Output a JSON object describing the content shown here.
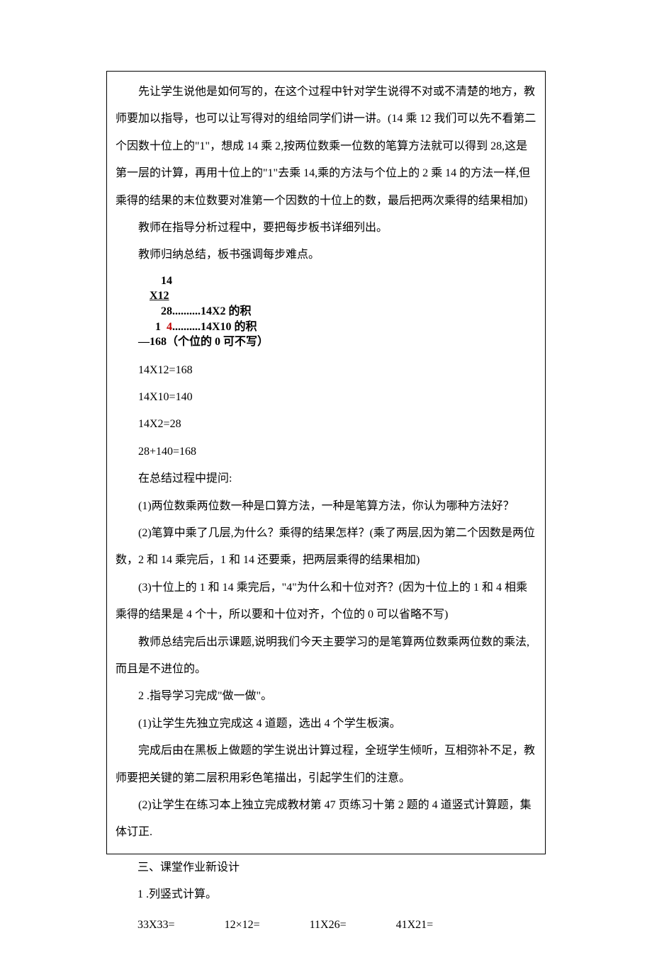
{
  "main": {
    "p1": "先让学生说他是如何写的，在这个过程中针对学生说得不对或不清楚的地方，教师要加以指导，也可以让写得对的组给同学们讲一讲。(14 乘 12 我们可以先不看第二个因数十位上的\"1\"，想成 14 乘 2,按两位数乘一位数的笔算方法就可以得到 28,这是第一层的计算，再用十位上的\"1\"去乘 14,乘的方法与个位上的 2 乘 14 的方法一样,但乘得的结果的末位数要对准第一个因数的十位上的数，最后把两次乘得的结果相加)",
    "p2": "教师在指导分析过程中，要把每步板书详细列出。",
    "p3": "教师归纳总结，板书强调每步难点。",
    "calc": {
      "l1": "        14",
      "l2_a": "    ",
      "l2_b": "X12",
      "l3": "        28..........14X2 的积",
      "l4_a": "      1  ",
      "l4_red": "4",
      "l4_b": "..........14X10 的积",
      "l5": "—168（个位的 0 可不写）"
    },
    "v1": "14X12=168",
    "v2": "14X10=140",
    "v3": "14X2=28",
    "v4": "28+140=168",
    "p4": "在总结过程中提问:",
    "q1": "(1)两位数乘两位数一种是口算方法，一种是笔算方法，你认为哪种方法好？",
    "q2": "(2)笔算中乘了几层,为什么？乘得的结果怎样？(乘了两层,因为第二个因数是两位数，2 和 14 乘完后，1 和 14 还要乘，把两层乘得的结果相加)",
    "q3": "(3)十位上的 1 和 14 乘完后，\"4\"为什么和十位对齐？(因为十位上的 1 和 4 相乘乘得的结果是 4 个十，所以要和十位对齐，个位的 0 可以省略不写)",
    "p5": "教师总结完后出示课题,说明我们今天主要学习的是笔算两位数乘两位数的乘法,而且是不进位的。",
    "s2": "2 .指导学习完成\"做一做\"。",
    "s2a": "(1)让学生先独立完成这 4 道题，选出 4 个学生板演。",
    "s2b": "完成后由在黑板上做题的学生说出计算过程，全班学生倾听，互相弥补不足，教师要把关键的第二层积用彩色笔描出，引起学生们的注意。",
    "s2c": "(2)让学生在练习本上独立完成教材第 47 页练习十第 2 题的 4 道竖式计算题，集体订正."
  },
  "outside": {
    "h3": "三、课堂作业新设计",
    "h3a": "1 .列竖式计算。",
    "hw": {
      "a": "33X33=",
      "b": "12×12=",
      "c": "11X26=",
      "d": "41X21="
    }
  }
}
